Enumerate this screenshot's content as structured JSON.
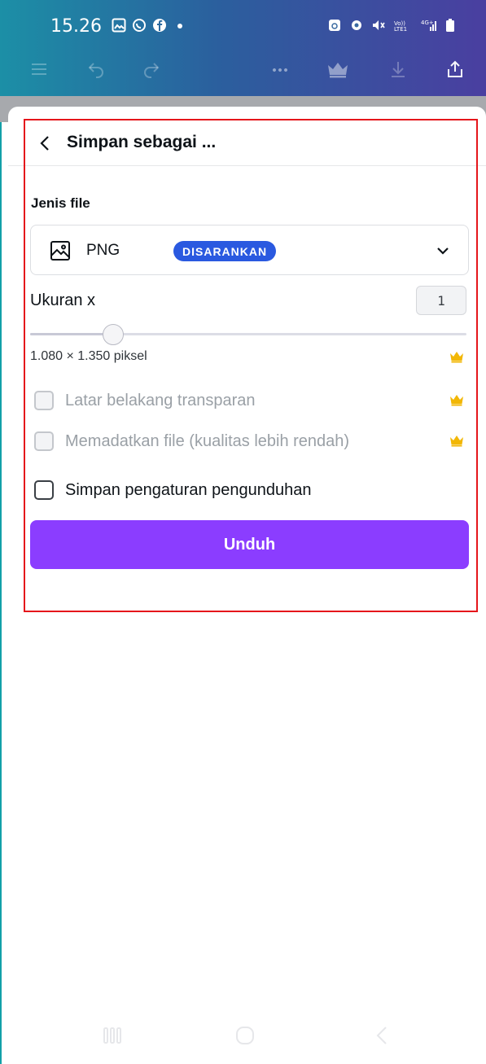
{
  "status_bar": {
    "time": "15.26",
    "left_icons": [
      "gallery-icon",
      "whatsapp-icon",
      "facebook-icon",
      "dot-icon"
    ],
    "right_icons": [
      "alarm-icon",
      "mute-icon",
      "volte-icon",
      "4g-icon",
      "signal-icon",
      "battery-icon"
    ]
  },
  "toolbar": {
    "icons": [
      "menu-icon",
      "undo-icon",
      "redo-icon",
      "more-icon",
      "crown-icon",
      "download-icon",
      "share-icon"
    ]
  },
  "sheet": {
    "title": "Simpan sebagai ...",
    "file_type_label": "Jenis file",
    "file_type_value": "PNG",
    "file_type_badge": "DISARANKAN",
    "size_label": "Ukuran x",
    "size_value": "1",
    "size_slider_fraction": 0.19,
    "dimensions": "1.080 × 1.350 piksel",
    "options": [
      {
        "label": "Latar belakang transparan",
        "enabled": false,
        "checked": false,
        "pro": true
      },
      {
        "label": "Memadatkan file (kualitas lebih rendah)",
        "enabled": false,
        "checked": false,
        "pro": true
      },
      {
        "label": "Simpan pengaturan pengunduhan",
        "enabled": true,
        "checked": false,
        "pro": false
      }
    ],
    "download_label": "Unduh"
  },
  "colors": {
    "accent": "#8b3dff",
    "badge": "#2a59e0",
    "crown": "#f2b705",
    "highlight": "#e5161b"
  }
}
